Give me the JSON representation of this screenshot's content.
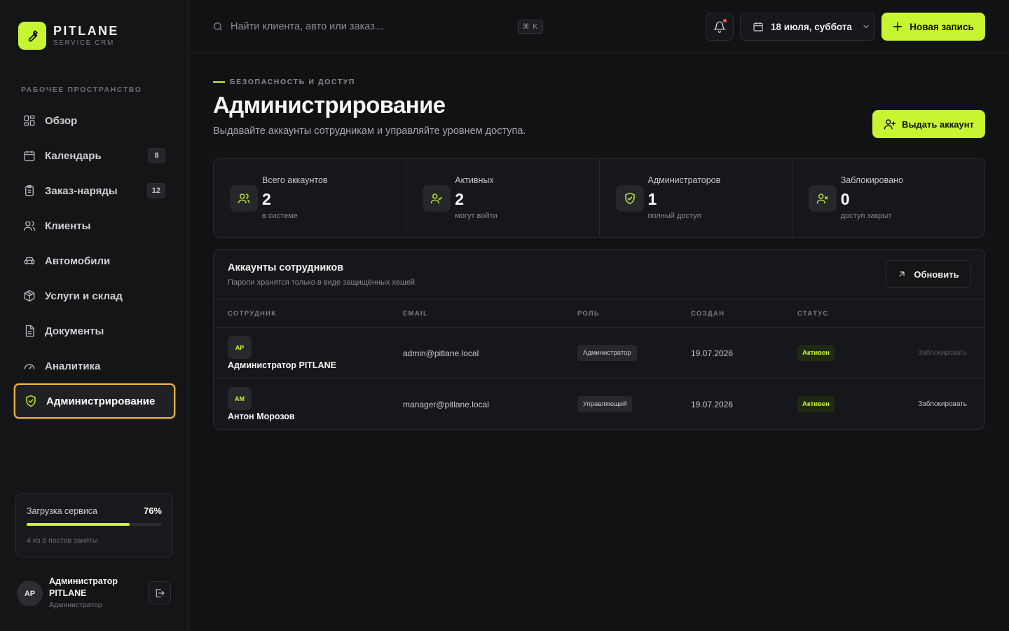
{
  "brand": {
    "name": "PITLANE",
    "sub": "SERVICE CRM"
  },
  "sidebar": {
    "section_label": "РАБОЧЕЕ ПРОСТРАНСТВО",
    "items": [
      {
        "label": "Обзор",
        "icon": "grid-icon"
      },
      {
        "label": "Календарь",
        "icon": "calendar-icon",
        "badge": "8"
      },
      {
        "label": "Заказ-наряды",
        "icon": "clipboard-icon",
        "badge": "12"
      },
      {
        "label": "Клиенты",
        "icon": "users-icon"
      },
      {
        "label": "Автомобили",
        "icon": "car-icon"
      },
      {
        "label": "Услуги и склад",
        "icon": "box-icon"
      },
      {
        "label": "Документы",
        "icon": "document-icon"
      },
      {
        "label": "Аналитика",
        "icon": "gauge-icon"
      },
      {
        "label": "Администрирование",
        "icon": "shield-icon",
        "active": true
      }
    ],
    "load": {
      "title": "Загрузка сервиса",
      "percent_label": "76%",
      "percent": 76,
      "sub": "4 из 5 постов заняты"
    },
    "user": {
      "initials": "АР",
      "name": "Администратор PITLANE",
      "role": "Администратор"
    }
  },
  "topbar": {
    "search_placeholder": "Найти клиента, авто или заказ...",
    "shortcut": "⌘ K",
    "date_label": "18 июля, суббота",
    "new_button": "Новая запись"
  },
  "header": {
    "eyebrow": "БЕЗОПАСНОСТЬ И ДОСТУП",
    "title": "Администрирование",
    "subtitle": "Выдавайте аккаунты сотрудникам и управляйте уровнем доступа.",
    "issue_button": "Выдать аккаунт"
  },
  "stats": [
    {
      "label": "Всего аккаунтов",
      "value": "2",
      "sub": "в системе",
      "icon": "users-icon"
    },
    {
      "label": "Активных",
      "value": "2",
      "sub": "могут войти",
      "icon": "user-check-icon"
    },
    {
      "label": "Администраторов",
      "value": "1",
      "sub": "полный доступ",
      "icon": "shield-check-icon"
    },
    {
      "label": "Заблокировано",
      "value": "0",
      "sub": "доступ закрыт",
      "icon": "user-x-icon"
    }
  ],
  "accounts": {
    "title": "Аккаунты сотрудников",
    "subtitle": "Пароли хранятся только в виде защищённых хешей",
    "refresh_button": "Обновить",
    "columns": [
      "СОТРУДНИК",
      "EMAIL",
      "РОЛЬ",
      "СОЗДАН",
      "СТАТУС"
    ],
    "rows": [
      {
        "initials": "АР",
        "name": "Администратор PITLANE",
        "email": "admin@pitlane.local",
        "role": "Администратор",
        "created": "19.07.2026",
        "status": "Активен",
        "action": "Заблокировать",
        "action_disabled": true
      },
      {
        "initials": "АМ",
        "name": "Антон Морозов",
        "email": "manager@pitlane.local",
        "role": "Управляющий",
        "created": "19.07.2026",
        "status": "Активен",
        "action": "Заблокировать",
        "action_disabled": false
      }
    ]
  },
  "colors": {
    "accent": "#c8f532",
    "background": "#111214",
    "panel": "#16171a",
    "active_outline": "#e8b23a",
    "notification_dot": "#ff4d4f"
  }
}
